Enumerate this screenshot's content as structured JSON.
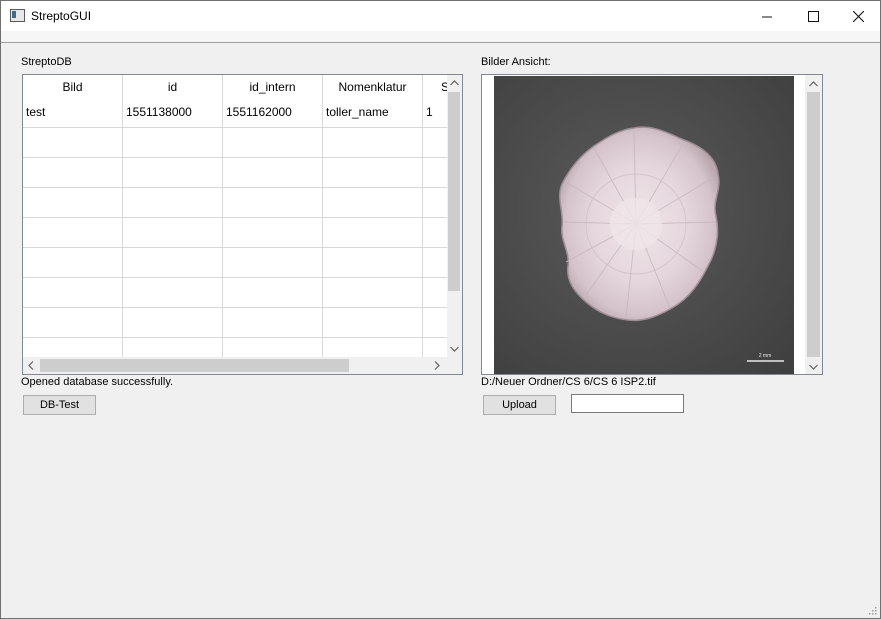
{
  "window": {
    "title": "StreptoGUI"
  },
  "left_panel": {
    "title": "StreptoDB",
    "table": {
      "columns": [
        "Bild",
        "id",
        "id_intern",
        "Nomenklatur",
        "S"
      ],
      "rows": [
        [
          "test",
          "1551138000",
          "1551162000",
          "toller_name",
          "1"
        ]
      ]
    },
    "status_text": "Opened database successfully.",
    "db_test_label": "DB-Test"
  },
  "right_panel": {
    "title": "Bilder Ansicht:",
    "image_scale_label": "2 mm",
    "file_path": "D:/Neuer Ordner/CS 6/CS 6 ISP2.tif",
    "upload_label": "Upload",
    "text_input_value": ""
  },
  "colors": {
    "title_bar": "#ffffff",
    "window_bg": "#f0f0f0",
    "photo_bg": "#4b4b4b",
    "colony": "#ece2e6"
  }
}
